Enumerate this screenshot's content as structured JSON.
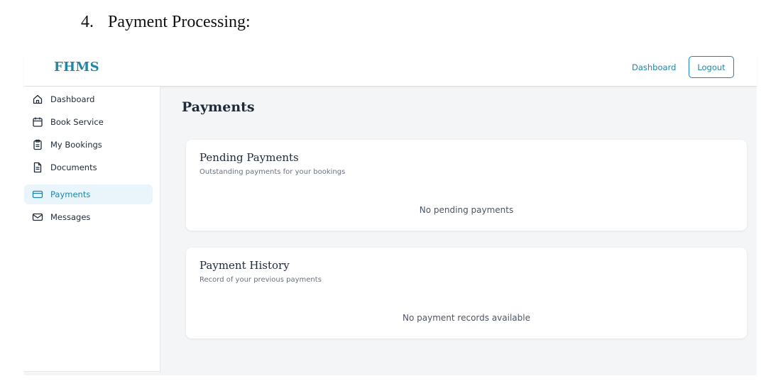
{
  "document": {
    "number": "4.",
    "heading": "Payment Processing:"
  },
  "header": {
    "logo": "FHMS",
    "nav_dashboard": "Dashboard",
    "logout_label": "Logout"
  },
  "sidebar": {
    "items": [
      {
        "label": "Dashboard",
        "icon": "home-icon",
        "active": false
      },
      {
        "label": "Book Service",
        "icon": "calendar-icon",
        "active": false
      },
      {
        "label": "My Bookings",
        "icon": "clipboard-icon",
        "active": false
      },
      {
        "label": "Documents",
        "icon": "file-text-icon",
        "active": false
      },
      {
        "label": "Payments",
        "icon": "credit-card-icon",
        "active": true
      },
      {
        "label": "Messages",
        "icon": "mail-icon",
        "active": false
      }
    ]
  },
  "main": {
    "title": "Payments",
    "cards": [
      {
        "title": "Pending Payments",
        "subtitle": "Outstanding payments for your bookings",
        "empty_text": "No pending payments"
      },
      {
        "title": "Payment History",
        "subtitle": "Record of your previous payments",
        "empty_text": "No payment records available"
      }
    ]
  },
  "colors": {
    "accent": "#1f86a9",
    "active_bg": "#eaf4fb",
    "page_bg": "#f4f5f7"
  }
}
